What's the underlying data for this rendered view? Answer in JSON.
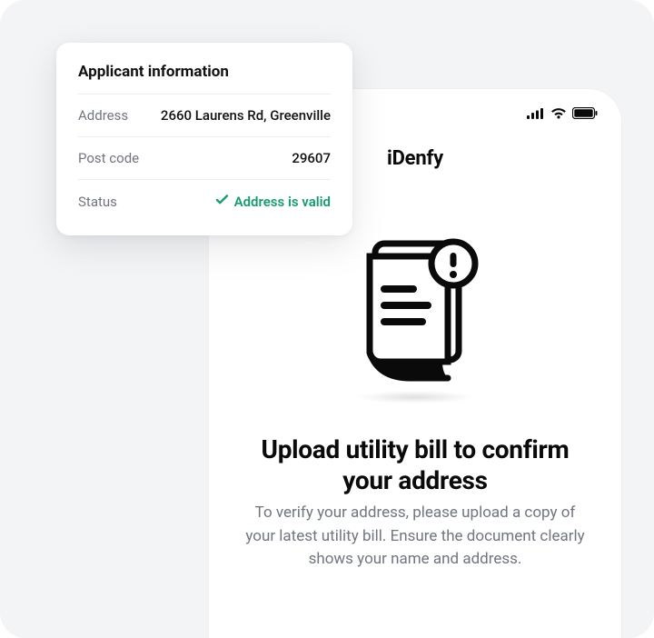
{
  "card": {
    "title": "Applicant information",
    "rows": [
      {
        "label": "Address",
        "value": "2660 Laurens Rd, Greenville"
      },
      {
        "label": "Post code",
        "value": "29607"
      },
      {
        "label": "Status",
        "value": "Address is valid"
      }
    ]
  },
  "phone": {
    "brand": "iDenfy",
    "headline": "Upload utility bill to confirm your address",
    "subcopy": "To verify your address, please upload a copy of your latest utility bill. Ensure the document clearly shows your name and address."
  }
}
